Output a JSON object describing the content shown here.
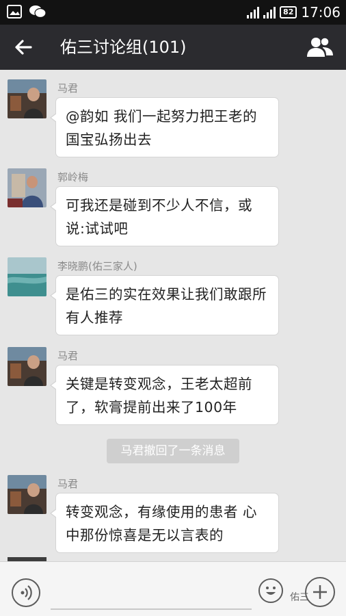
{
  "status_bar": {
    "time": "17:06",
    "battery": "82",
    "icons": [
      "image-icon",
      "wechat-icon",
      "signal-icon",
      "signal-icon",
      "battery-icon"
    ]
  },
  "header": {
    "title": "佑三讨论组(101)",
    "back_icon": "arrow-left-icon",
    "members_icon": "group-members-icon"
  },
  "messages": [
    {
      "sender": "马君",
      "text": "@韵如 我们一起努力把王老的国宝弘扬出去"
    },
    {
      "sender": "郭岭梅",
      "text": "可我还是碰到不少人不信，或说:试试吧"
    },
    {
      "sender": "李晓鹏(佑三家人)",
      "text": "是佑三的实在效果让我们敢跟所有人推荐"
    },
    {
      "sender": "马君",
      "text": "关键是转变观念，王老太超前了，软膏提前出来了100年"
    },
    {
      "sender": "马君",
      "text": "转变观念，有缘使用的患者 心中那份惊喜是无以言表的"
    }
  ],
  "system_notice": "马君撤回了一条消息",
  "input_bar": {
    "voice_icon": "voice-icon",
    "emoji_icon": "smiley-icon",
    "plus_icon": "plus-icon",
    "watermark": "佑三"
  }
}
